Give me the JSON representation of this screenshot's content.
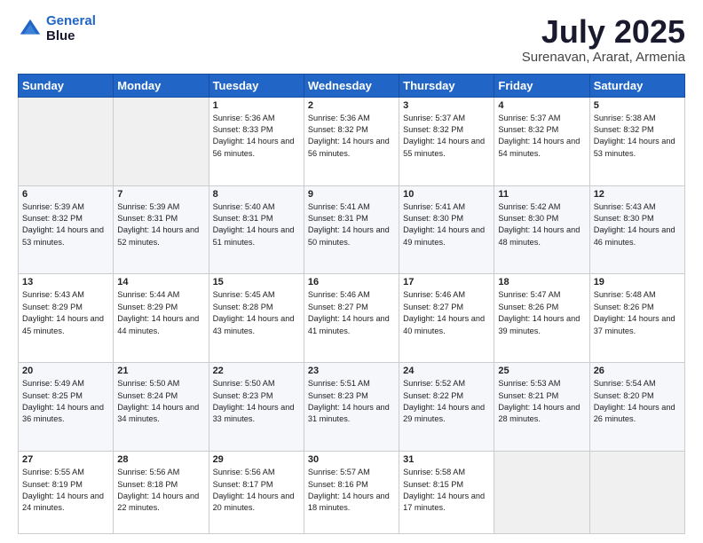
{
  "logo": {
    "line1": "General",
    "line2": "Blue"
  },
  "title": "July 2025",
  "subtitle": "Surenavan, Ararat, Armenia",
  "weekdays": [
    "Sunday",
    "Monday",
    "Tuesday",
    "Wednesday",
    "Thursday",
    "Friday",
    "Saturday"
  ],
  "weeks": [
    [
      {
        "day": "",
        "info": ""
      },
      {
        "day": "",
        "info": ""
      },
      {
        "day": "1",
        "info": "Sunrise: 5:36 AM\nSunset: 8:33 PM\nDaylight: 14 hours and 56 minutes."
      },
      {
        "day": "2",
        "info": "Sunrise: 5:36 AM\nSunset: 8:32 PM\nDaylight: 14 hours and 56 minutes."
      },
      {
        "day": "3",
        "info": "Sunrise: 5:37 AM\nSunset: 8:32 PM\nDaylight: 14 hours and 55 minutes."
      },
      {
        "day": "4",
        "info": "Sunrise: 5:37 AM\nSunset: 8:32 PM\nDaylight: 14 hours and 54 minutes."
      },
      {
        "day": "5",
        "info": "Sunrise: 5:38 AM\nSunset: 8:32 PM\nDaylight: 14 hours and 53 minutes."
      }
    ],
    [
      {
        "day": "6",
        "info": "Sunrise: 5:39 AM\nSunset: 8:32 PM\nDaylight: 14 hours and 53 minutes."
      },
      {
        "day": "7",
        "info": "Sunrise: 5:39 AM\nSunset: 8:31 PM\nDaylight: 14 hours and 52 minutes."
      },
      {
        "day": "8",
        "info": "Sunrise: 5:40 AM\nSunset: 8:31 PM\nDaylight: 14 hours and 51 minutes."
      },
      {
        "day": "9",
        "info": "Sunrise: 5:41 AM\nSunset: 8:31 PM\nDaylight: 14 hours and 50 minutes."
      },
      {
        "day": "10",
        "info": "Sunrise: 5:41 AM\nSunset: 8:30 PM\nDaylight: 14 hours and 49 minutes."
      },
      {
        "day": "11",
        "info": "Sunrise: 5:42 AM\nSunset: 8:30 PM\nDaylight: 14 hours and 48 minutes."
      },
      {
        "day": "12",
        "info": "Sunrise: 5:43 AM\nSunset: 8:30 PM\nDaylight: 14 hours and 46 minutes."
      }
    ],
    [
      {
        "day": "13",
        "info": "Sunrise: 5:43 AM\nSunset: 8:29 PM\nDaylight: 14 hours and 45 minutes."
      },
      {
        "day": "14",
        "info": "Sunrise: 5:44 AM\nSunset: 8:29 PM\nDaylight: 14 hours and 44 minutes."
      },
      {
        "day": "15",
        "info": "Sunrise: 5:45 AM\nSunset: 8:28 PM\nDaylight: 14 hours and 43 minutes."
      },
      {
        "day": "16",
        "info": "Sunrise: 5:46 AM\nSunset: 8:27 PM\nDaylight: 14 hours and 41 minutes."
      },
      {
        "day": "17",
        "info": "Sunrise: 5:46 AM\nSunset: 8:27 PM\nDaylight: 14 hours and 40 minutes."
      },
      {
        "day": "18",
        "info": "Sunrise: 5:47 AM\nSunset: 8:26 PM\nDaylight: 14 hours and 39 minutes."
      },
      {
        "day": "19",
        "info": "Sunrise: 5:48 AM\nSunset: 8:26 PM\nDaylight: 14 hours and 37 minutes."
      }
    ],
    [
      {
        "day": "20",
        "info": "Sunrise: 5:49 AM\nSunset: 8:25 PM\nDaylight: 14 hours and 36 minutes."
      },
      {
        "day": "21",
        "info": "Sunrise: 5:50 AM\nSunset: 8:24 PM\nDaylight: 14 hours and 34 minutes."
      },
      {
        "day": "22",
        "info": "Sunrise: 5:50 AM\nSunset: 8:23 PM\nDaylight: 14 hours and 33 minutes."
      },
      {
        "day": "23",
        "info": "Sunrise: 5:51 AM\nSunset: 8:23 PM\nDaylight: 14 hours and 31 minutes."
      },
      {
        "day": "24",
        "info": "Sunrise: 5:52 AM\nSunset: 8:22 PM\nDaylight: 14 hours and 29 minutes."
      },
      {
        "day": "25",
        "info": "Sunrise: 5:53 AM\nSunset: 8:21 PM\nDaylight: 14 hours and 28 minutes."
      },
      {
        "day": "26",
        "info": "Sunrise: 5:54 AM\nSunset: 8:20 PM\nDaylight: 14 hours and 26 minutes."
      }
    ],
    [
      {
        "day": "27",
        "info": "Sunrise: 5:55 AM\nSunset: 8:19 PM\nDaylight: 14 hours and 24 minutes."
      },
      {
        "day": "28",
        "info": "Sunrise: 5:56 AM\nSunset: 8:18 PM\nDaylight: 14 hours and 22 minutes."
      },
      {
        "day": "29",
        "info": "Sunrise: 5:56 AM\nSunset: 8:17 PM\nDaylight: 14 hours and 20 minutes."
      },
      {
        "day": "30",
        "info": "Sunrise: 5:57 AM\nSunset: 8:16 PM\nDaylight: 14 hours and 18 minutes."
      },
      {
        "day": "31",
        "info": "Sunrise: 5:58 AM\nSunset: 8:15 PM\nDaylight: 14 hours and 17 minutes."
      },
      {
        "day": "",
        "info": ""
      },
      {
        "day": "",
        "info": ""
      }
    ]
  ]
}
